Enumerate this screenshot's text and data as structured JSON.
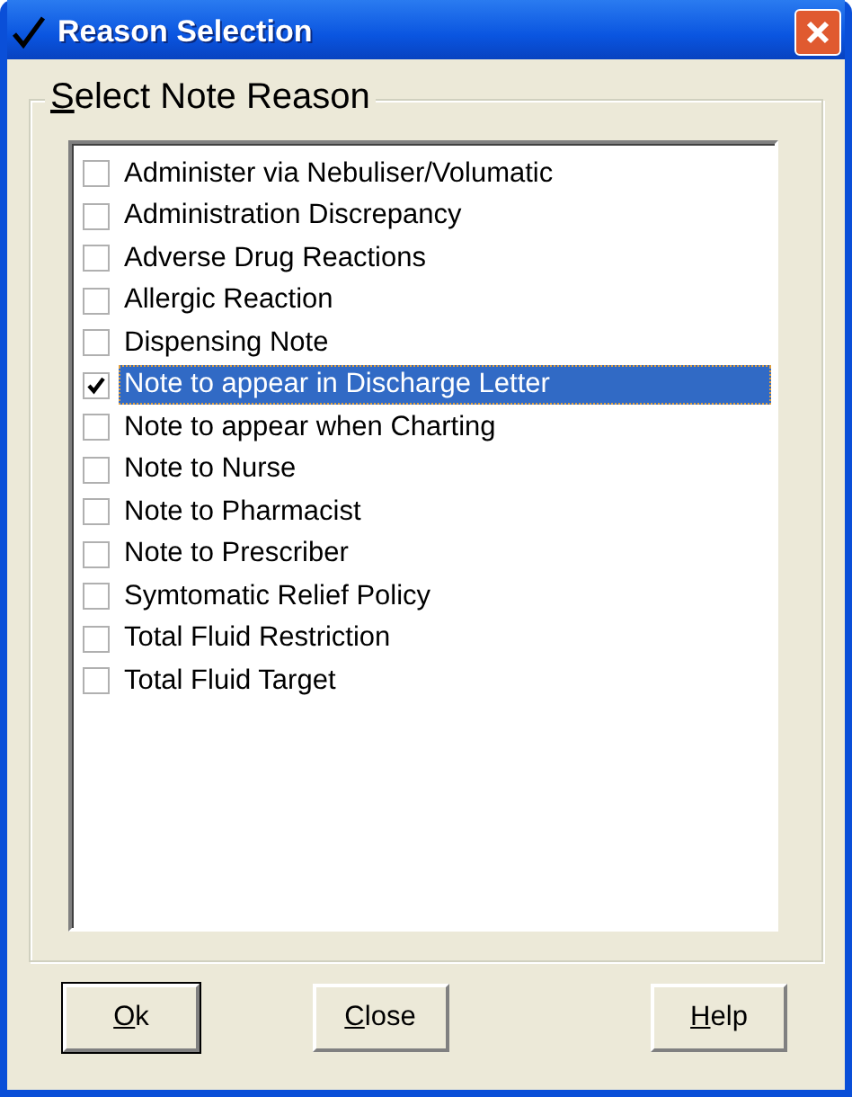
{
  "window": {
    "title": "Reason Selection"
  },
  "group": {
    "title": "Select Note Reason"
  },
  "reasons": [
    {
      "label": "Administer via Nebuliser/Volumatic",
      "checked": false,
      "selected": false
    },
    {
      "label": "Administration Discrepancy",
      "checked": false,
      "selected": false
    },
    {
      "label": "Adverse Drug Reactions",
      "checked": false,
      "selected": false
    },
    {
      "label": "Allergic Reaction",
      "checked": false,
      "selected": false
    },
    {
      "label": "Dispensing Note",
      "checked": false,
      "selected": false
    },
    {
      "label": "Note to appear in Discharge Letter",
      "checked": true,
      "selected": true
    },
    {
      "label": "Note to appear when Charting",
      "checked": false,
      "selected": false
    },
    {
      "label": "Note to Nurse",
      "checked": false,
      "selected": false
    },
    {
      "label": "Note to Pharmacist",
      "checked": false,
      "selected": false
    },
    {
      "label": "Note to Prescriber",
      "checked": false,
      "selected": false
    },
    {
      "label": "Symtomatic Relief Policy",
      "checked": false,
      "selected": false
    },
    {
      "label": "Total Fluid Restriction",
      "checked": false,
      "selected": false
    },
    {
      "label": "Total Fluid Target",
      "checked": false,
      "selected": false
    }
  ],
  "buttons": [
    {
      "label": "Ok",
      "default": true
    },
    {
      "label": "Close",
      "default": false
    },
    {
      "label": "Help",
      "default": false
    }
  ]
}
